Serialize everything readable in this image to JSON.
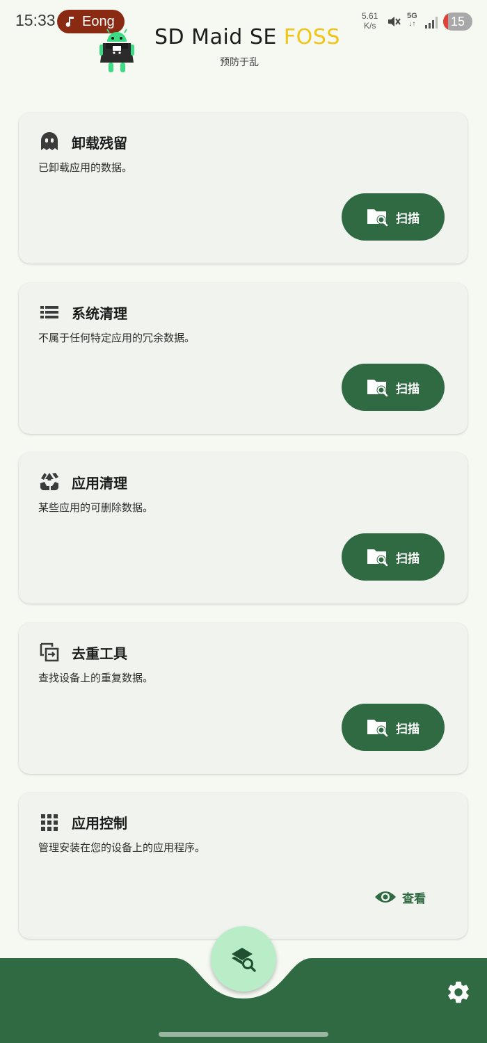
{
  "status_bar": {
    "time": "15:33",
    "pill_label": "Eong",
    "net_speed_value": "5.61",
    "net_speed_unit": "K/s",
    "network": "5G",
    "battery": "15"
  },
  "header": {
    "title_main": "SD Maid SE ",
    "title_accent": "FOSS",
    "tagline": "预防于乱"
  },
  "cards": [
    {
      "icon": "ghost-icon",
      "title": "卸载残留",
      "desc": "已卸载应用的数据。",
      "action": "扫描"
    },
    {
      "icon": "list-icon",
      "title": "系统清理",
      "desc": "不属于任何特定应用的冗余数据。",
      "action": "扫描"
    },
    {
      "icon": "recycle-icon",
      "title": "应用清理",
      "desc": "某些应用的可删除数据。",
      "action": "扫描"
    },
    {
      "icon": "duplicate-icon",
      "title": "去重工具",
      "desc": "查找设备上的重复数据。",
      "action": "扫描"
    },
    {
      "icon": "grid-icon",
      "title": "应用控制",
      "desc": "管理安装在您的设备上的应用程序。",
      "action": "查看"
    }
  ],
  "colors": {
    "accent": "#2f6a42",
    "foss": "#f2c416",
    "background": "#f5f9f2",
    "card": "#f1f4ee",
    "fab": "#b8edc8"
  }
}
